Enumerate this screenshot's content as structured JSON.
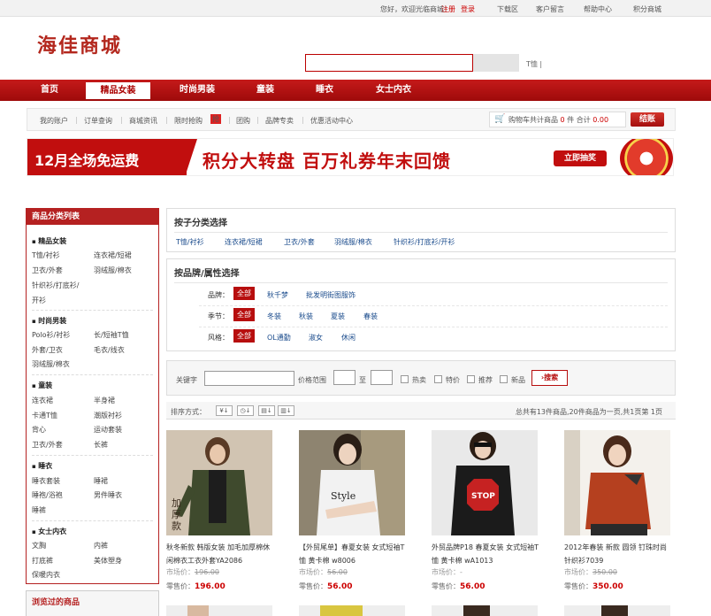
{
  "topbar": {
    "welcome": "您好，欢迎光临商城！",
    "register": "注册",
    "login": "登录",
    "links": [
      "下载区",
      "客户留言",
      "帮助中心",
      "积分商城"
    ]
  },
  "logo": "海佳商城",
  "search": {
    "value": "",
    "hot_word": "T恤 |"
  },
  "nav": [
    "首页",
    "精品女装",
    "时尚男装",
    "童装",
    "睡衣",
    "女士内衣"
  ],
  "subnav": {
    "links": [
      "我的账户",
      "订单查询",
      "商城资讯",
      "限时抢购",
      "团购",
      "品牌专卖",
      "优惠活动中心"
    ],
    "hot_tag": "抢",
    "cart_prefix": "购物车共计商品",
    "cart_count": "0",
    "cart_unit": "件",
    "cart_total_label": "合计",
    "cart_total": "0.00",
    "checkout": "结账"
  },
  "banner": {
    "left_text": "12月全场免运费",
    "mid_text": "积分大转盘  百万礼券年末回馈",
    "button": "立即抽奖"
  },
  "sidebar": {
    "title": "商品分类列表",
    "groups": [
      {
        "name": "精品女装",
        "items": [
          "T恤/衬衫",
          "连衣裙/短裙",
          "卫衣/外套",
          "羽绒服/棉衣",
          "针织衫/打底衫/",
          "开衫"
        ]
      },
      {
        "name": "时尚男装",
        "items": [
          "Polo衫/衬衫",
          "长/短袖T恤",
          "外套/卫衣",
          "毛衣/线衣",
          "羽绒服/棉衣"
        ]
      },
      {
        "name": "童装",
        "items": [
          "连衣裙",
          "半身裙",
          "卡通T恤",
          "潮版衬衫",
          "背心",
          "运动套装",
          "卫衣/外套",
          "长裤"
        ]
      },
      {
        "name": "睡衣",
        "items": [
          "睡衣套装",
          "睡裙",
          "睡袍/浴袍",
          "男件睡衣",
          "睡裤"
        ]
      },
      {
        "name": "女士内衣",
        "items": [
          "文胸",
          "内裤",
          "打底裤",
          "美体塑身",
          "保暖内衣"
        ]
      }
    ],
    "viewed_title": "浏览过的商品"
  },
  "filter_cat": {
    "title": "按子分类选择",
    "items": [
      "T恤/衬衫",
      "连衣裙/短裙",
      "卫衣/外套",
      "羽绒服/棉衣",
      "针织衫/打底衫/开衫"
    ]
  },
  "filter_attr": {
    "title": "按品牌/属性选择",
    "all_label": "全部",
    "rows": [
      {
        "label": "品牌：",
        "options": [
          "秋千梦",
          "批发明街图服饰"
        ]
      },
      {
        "label": "季节：",
        "options": [
          "冬装",
          "秋装",
          "夏装",
          "春装"
        ]
      },
      {
        "label": "风格：",
        "options": [
          "OL通勤",
          "淑女",
          "休闲"
        ]
      }
    ]
  },
  "search_panel": {
    "keyword_label": "关键字",
    "price_label": "价格范围",
    "to_label": "至",
    "checks": [
      "热卖",
      "特价",
      "推荐",
      "新品"
    ],
    "button": "搜索"
  },
  "sort": {
    "label": "排序方式：",
    "summary": "总共有13件商品,20件商品为一页,共1页第  1页"
  },
  "products": [
    {
      "name": "秋冬新款 韩版女装 加毛加厚棉休闲棉衣工衣外套YA2086",
      "market_label": "市场价：",
      "market": "196.00",
      "price_label": "零售价：",
      "price": "196.00",
      "badge": "加厚款"
    },
    {
      "name": "【外贸尾单】春夏女装 女式短袖T恤 黄卡棉 w8006",
      "market_label": "市场价：",
      "market": "56.00",
      "price_label": "零售价：",
      "price": "56.00"
    },
    {
      "name": "外贸品牌P18 春夏女装 女式短袖T恤 黄卡棉 wA1013",
      "market_label": "市场价：",
      "market": "-",
      "price_label": "零售价：",
      "price": "56.00"
    },
    {
      "name": "2012年春装 新款 圆领 钉珠时尚 针织衫7039",
      "market_label": "市场价：",
      "market": "350.00",
      "price_label": "零售价：",
      "price": "350.00"
    }
  ],
  "colors": {
    "brand_red": "#b70e0e",
    "link_blue": "#1a4b8c"
  }
}
